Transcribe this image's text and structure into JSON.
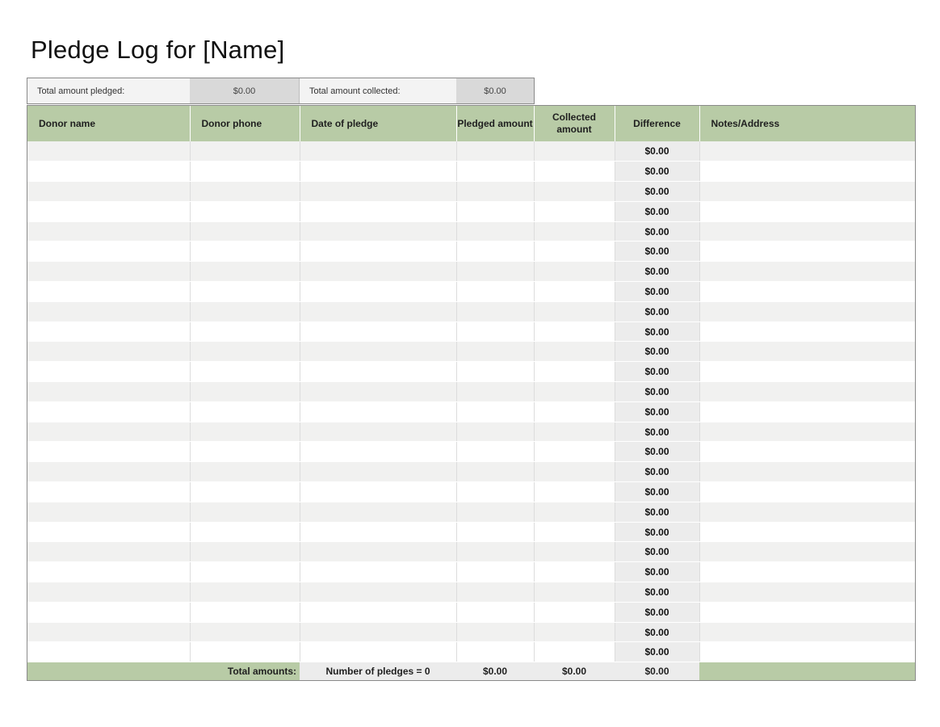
{
  "title": "Pledge Log for [Name]",
  "summary": {
    "total_pledged_label": "Total amount pledged:",
    "total_pledged_value": "$0.00",
    "total_collected_label": "Total amount collected:",
    "total_collected_value": "$0.00"
  },
  "columns": [
    "Donor name",
    "Donor phone",
    "Date of pledge",
    "Pledged amount",
    "Collected amount",
    "Difference",
    "Notes/Address"
  ],
  "rows": [
    {
      "difference": "$0.00"
    },
    {
      "difference": "$0.00"
    },
    {
      "difference": "$0.00"
    },
    {
      "difference": "$0.00"
    },
    {
      "difference": "$0.00"
    },
    {
      "difference": "$0.00"
    },
    {
      "difference": "$0.00"
    },
    {
      "difference": "$0.00"
    },
    {
      "difference": "$0.00"
    },
    {
      "difference": "$0.00"
    },
    {
      "difference": "$0.00"
    },
    {
      "difference": "$0.00"
    },
    {
      "difference": "$0.00"
    },
    {
      "difference": "$0.00"
    },
    {
      "difference": "$0.00"
    },
    {
      "difference": "$0.00"
    },
    {
      "difference": "$0.00"
    },
    {
      "difference": "$0.00"
    },
    {
      "difference": "$0.00"
    },
    {
      "difference": "$0.00"
    },
    {
      "difference": "$0.00"
    },
    {
      "difference": "$0.00"
    },
    {
      "difference": "$0.00"
    },
    {
      "difference": "$0.00"
    },
    {
      "difference": "$0.00"
    },
    {
      "difference": "$0.00"
    }
  ],
  "footer": {
    "total_label": "Total amounts:",
    "pledge_count": "Number of pledges = 0",
    "pledged_total": "$0.00",
    "collected_total": "$0.00",
    "difference_total": "$0.00"
  },
  "colors": {
    "header_green": "#b8cba6",
    "row_stripe": "#f1f1f0",
    "summary_value_bg": "#d9d9d9"
  }
}
